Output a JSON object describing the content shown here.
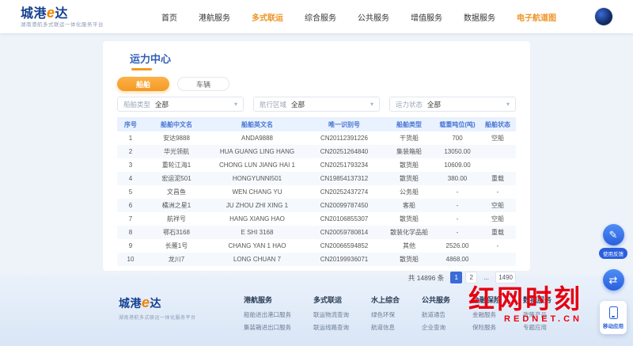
{
  "brand": {
    "name_part1": "城港",
    "name_e": "e",
    "name_part2": "达",
    "tagline": "湖南港航多式联运一体化服务平台"
  },
  "nav": {
    "items": [
      {
        "label": "首页",
        "active": false,
        "highlight": false
      },
      {
        "label": "港航服务",
        "active": false,
        "highlight": false
      },
      {
        "label": "多式联运",
        "active": true,
        "highlight": false
      },
      {
        "label": "综合服务",
        "active": false,
        "highlight": false
      },
      {
        "label": "公共服务",
        "active": false,
        "highlight": false
      },
      {
        "label": "增值服务",
        "active": false,
        "highlight": false
      },
      {
        "label": "数据服务",
        "active": false,
        "highlight": false
      },
      {
        "label": "电子航道图",
        "active": false,
        "highlight": true
      }
    ]
  },
  "page": {
    "title": "运力中心"
  },
  "tabs": [
    {
      "label": "船舶",
      "active": true
    },
    {
      "label": "车辆",
      "active": false
    }
  ],
  "filters": [
    {
      "label": "船舶类型",
      "value": "全部"
    },
    {
      "label": "航行区域",
      "value": "全部"
    },
    {
      "label": "运力状态",
      "value": "全部"
    }
  ],
  "table": {
    "columns": [
      "序号",
      "船舶中文名",
      "船舶英文名",
      "唯一识别号",
      "船舶类型",
      "载重吨位(吨)",
      "船舶状态"
    ],
    "rows": [
      [
        "1",
        "安达9888",
        "ANDA9888",
        "CN20112391226",
        "干货船",
        "700",
        "空船"
      ],
      [
        "2",
        "华光领航",
        "HUA GUANG LING HANG",
        "CN20251264840",
        "集装箱船",
        "13050.00",
        ""
      ],
      [
        "3",
        "重轮江海1",
        "CHONG LUN JIANG HAI 1",
        "CN20251793234",
        "散货船",
        "10609.00",
        ""
      ],
      [
        "4",
        "宏运泥501",
        "HONGYUNNI501",
        "CN19854137312",
        "散货船",
        "380.00",
        "重载"
      ],
      [
        "5",
        "文昌鱼",
        "WEN CHANG YU",
        "CN20252437274",
        "公务船",
        "-",
        "-"
      ],
      [
        "6",
        "橘洲之星1",
        "JU ZHOU ZHI XING 1",
        "CN20099787450",
        "客船",
        "-",
        "空船"
      ],
      [
        "7",
        "航祥号",
        "HANG XIANG HAO",
        "CN20106855307",
        "散货船",
        "-",
        "空船"
      ],
      [
        "8",
        "鄂石3168",
        "E SHI 3168",
        "CN20059780814",
        "散装化学品船",
        "-",
        "重载"
      ],
      [
        "9",
        "长雁1号",
        "CHANG YAN 1 HAO",
        "CN20066594852",
        "其他",
        "2526.00",
        "-"
      ],
      [
        "10",
        "龙川7",
        "LONG CHUAN 7",
        "CN20199936071",
        "散货船",
        "4868.00",
        ""
      ]
    ]
  },
  "pagination": {
    "total_text": "共 14896 条",
    "pages": [
      "1",
      "2",
      "...",
      "1490"
    ],
    "active_index": 0
  },
  "footer": {
    "columns": [
      {
        "title": "港航服务",
        "links": [
          "船舶进出港口服务",
          "集装箱进出口服务"
        ]
      },
      {
        "title": "多式联运",
        "links": [
          "联运物流查询",
          "联运线路查询"
        ]
      },
      {
        "title": "水上综合",
        "links": [
          "绿色环保",
          "航道信息"
        ]
      },
      {
        "title": "公共服务",
        "links": [
          "航道通告",
          "企业查询"
        ]
      },
      {
        "title": "金融保险",
        "links": [
          "金融服务",
          "保险服务"
        ]
      },
      {
        "title": "数据服务",
        "links": [
          "政策产品",
          "专题应用"
        ]
      }
    ]
  },
  "watermark": {
    "title": "红网时刻",
    "subtitle": "REDNET.CN"
  },
  "floating": {
    "feedback_label": "使用反馈",
    "mobile_label": "移动应用"
  },
  "colors": {
    "primary_blue": "#2e5db8",
    "accent_orange": "#f59a23",
    "table_header_blue": "#4a77d4",
    "watermark_red": "#e60012",
    "float_blue": "#2a60dd"
  }
}
